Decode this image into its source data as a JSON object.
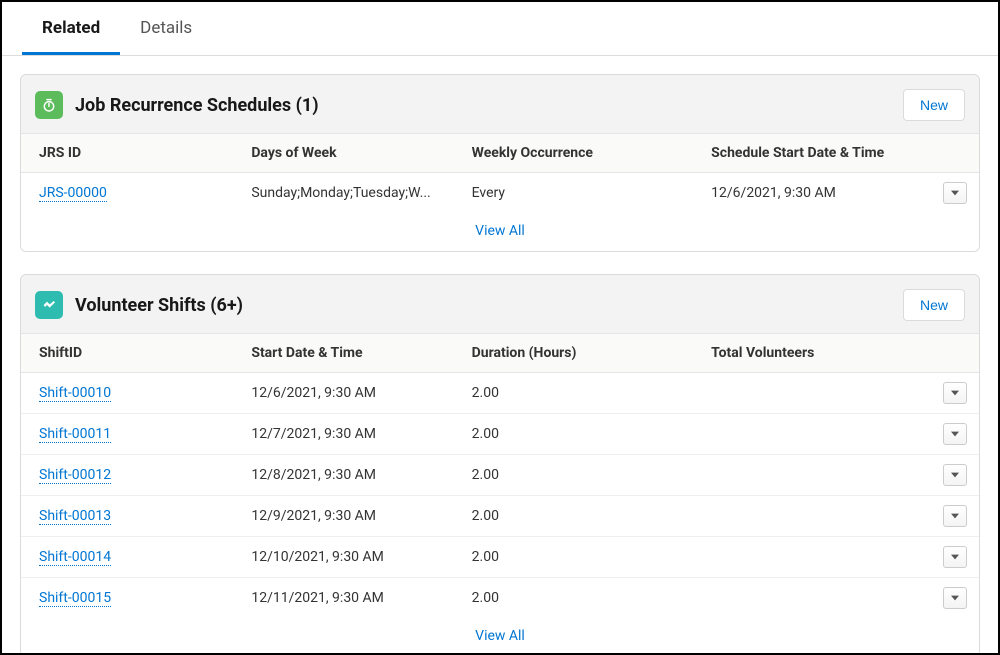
{
  "tabs": {
    "related": "Related",
    "details": "Details"
  },
  "jrs": {
    "title": "Job Recurrence Schedules (1)",
    "newLabel": "New",
    "columns": [
      "JRS ID",
      "Days of Week",
      "Weekly Occurrence",
      "Schedule Start Date & Time"
    ],
    "rows": [
      {
        "id": "JRS-00000",
        "days": "Sunday;Monday;Tuesday;W...",
        "occurrence": "Every",
        "start": "12/6/2021, 9:30 AM"
      }
    ],
    "viewAll": "View All"
  },
  "shifts": {
    "title": "Volunteer Shifts (6+)",
    "newLabel": "New",
    "columns": [
      "ShiftID",
      "Start Date & Time",
      "Duration (Hours)",
      "Total Volunteers"
    ],
    "rows": [
      {
        "id": "Shift-00010",
        "start": "12/6/2021, 9:30 AM",
        "duration": "2.00",
        "total": ""
      },
      {
        "id": "Shift-00011",
        "start": "12/7/2021, 9:30 AM",
        "duration": "2.00",
        "total": ""
      },
      {
        "id": "Shift-00012",
        "start": "12/8/2021, 9:30 AM",
        "duration": "2.00",
        "total": ""
      },
      {
        "id": "Shift-00013",
        "start": "12/9/2021, 9:30 AM",
        "duration": "2.00",
        "total": ""
      },
      {
        "id": "Shift-00014",
        "start": "12/10/2021, 9:30 AM",
        "duration": "2.00",
        "total": ""
      },
      {
        "id": "Shift-00015",
        "start": "12/11/2021, 9:30 AM",
        "duration": "2.00",
        "total": ""
      }
    ],
    "viewAll": "View All"
  }
}
